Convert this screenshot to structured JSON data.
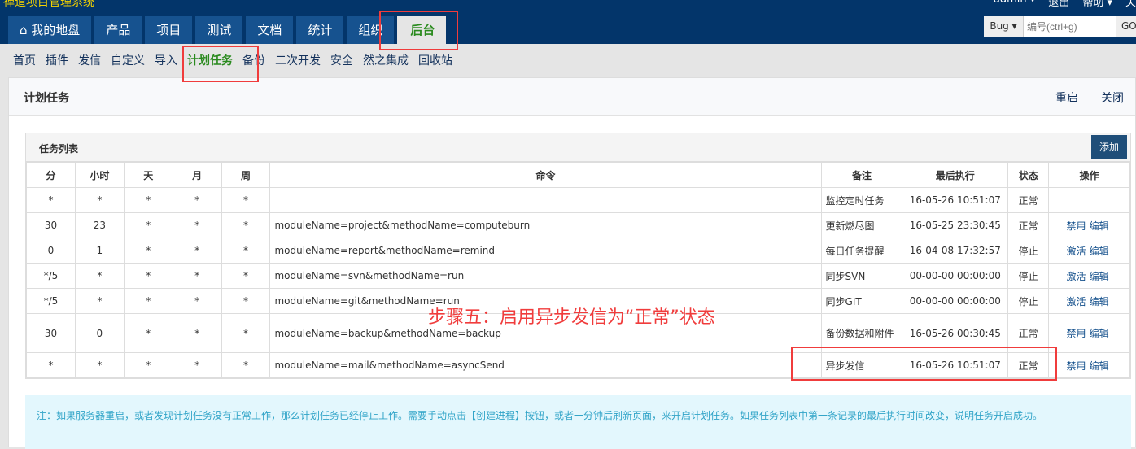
{
  "app": {
    "title": "禅道项目管理系统"
  },
  "userbar": {
    "user": "admin ▾",
    "logout": "退出",
    "help": "帮助 ▾",
    "about": "关"
  },
  "tabs": [
    "我的地盘",
    "产品",
    "项目",
    "测试",
    "文档",
    "统计",
    "组织",
    "后台"
  ],
  "search": {
    "type": "Bug ▾",
    "placeholder": "编号(ctrl+g)",
    "go": "GO"
  },
  "subnav": [
    "首页",
    "插件",
    "发信",
    "自定义",
    "导入",
    "计划任务",
    "备份",
    "二次开发",
    "安全",
    "然之集成",
    "回收站"
  ],
  "page": {
    "title": "计划任务",
    "restart": "重启",
    "close": "关闭"
  },
  "panel": {
    "title": "任务列表",
    "add": "添加",
    "columns": [
      "分",
      "小时",
      "天",
      "月",
      "周",
      "命令",
      "备注",
      "最后执行",
      "状态",
      "操作"
    ],
    "rows": [
      [
        "*",
        "*",
        "*",
        "*",
        "*",
        "",
        "监控定时任务",
        "16-05-26 10:51:07",
        "正常",
        "",
        ""
      ],
      [
        "30",
        "23",
        "*",
        "*",
        "*",
        "moduleName=project&methodName=computeburn",
        "更新燃尽图",
        "16-05-25 23:30:45",
        "正常",
        "禁用",
        "编辑"
      ],
      [
        "0",
        "1",
        "*",
        "*",
        "*",
        "moduleName=report&methodName=remind",
        "每日任务提醒",
        "16-04-08 17:32:57",
        "停止",
        "激活",
        "编辑"
      ],
      [
        "*/5",
        "*",
        "*",
        "*",
        "*",
        "moduleName=svn&methodName=run",
        "同步SVN",
        "00-00-00 00:00:00",
        "停止",
        "激活",
        "编辑"
      ],
      [
        "*/5",
        "*",
        "*",
        "*",
        "*",
        "moduleName=git&methodName=run",
        "同步GIT",
        "00-00-00 00:00:00",
        "停止",
        "激活",
        "编辑"
      ],
      [
        "30",
        "0",
        "*",
        "*",
        "*",
        "moduleName=backup&methodName=backup",
        "备份数据和附件",
        "16-05-26 00:30:45",
        "正常",
        "禁用",
        "编辑"
      ],
      [
        "*",
        "*",
        "*",
        "*",
        "*",
        "moduleName=mail&methodName=asyncSend",
        "异步发信",
        "16-05-26 10:51:07",
        "正常",
        "禁用",
        "编辑"
      ]
    ]
  },
  "notice": "注：如果服务器重启，或者发现计划任务没有正常工作，那么计划任务已经停止工作。需要手动点击【创建进程】按钮，或者一分钟后刷新页面，来开启计划任务。如果任务列表中第一条记录的最后执行时间改变，说明任务开启成功。",
  "annotation": "步骤五：启用异步发信为“正常”状态"
}
